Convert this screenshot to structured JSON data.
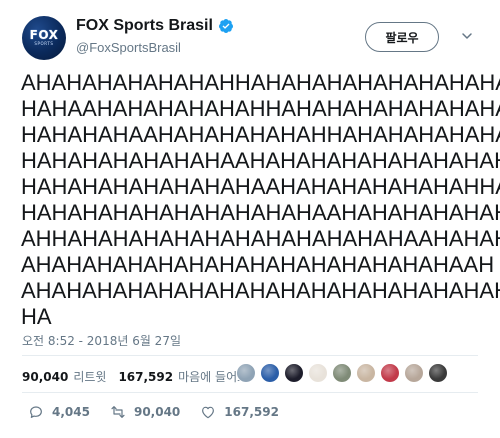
{
  "account": {
    "display_name": "FOX Sports Brasil",
    "handle": "@FoxSportsBrasil",
    "verified": true,
    "avatar_text": "FOX",
    "avatar_subtext": "SPORTS"
  },
  "follow_button": {
    "label": "팔로우"
  },
  "tweet": {
    "lines": [
      "AHAHAHAHAHAHAHHAHAHAHAHAHAHAHAHA",
      "HAHAAHAHAHAHAHAHHAHAHAHAHAHAHAHA",
      "HAHAHAHAAHAHAHAHAHAHHAHAHAHAHAHA",
      "HAHAHAHAHAHAHAAHAHAHAHAHAHAHAHAHA",
      "HAHAHAHAHAHAHAHAAHAHAHAHAHAHAHHA",
      "HAHAHAHAHAHAHAHAHAHAAHAHAHAHAHAH",
      "AHHAHAHAHAHAHAHAHAHAHAHAHAAHAHAH",
      "AHAHAHAHAHAHAHAHAHAHAHAHAHAHAAH",
      "AHAHAHAHAHAHAHAHAHAHAHAHAHAHAHAHA",
      "HA"
    ]
  },
  "timestamp": "오전 8:52 - 2018년 6월 27일",
  "stats": {
    "retweets_count": "90,040",
    "retweets_label": "리트윗",
    "likes_count": "167,592",
    "likes_label": "마음에 들어요"
  },
  "likers": [
    {
      "icon": "avatar-1",
      "color": "#8fa3b5"
    },
    {
      "icon": "avatar-2",
      "color": "#2b5ea8"
    },
    {
      "icon": "avatar-3",
      "color": "#1d1d2b"
    },
    {
      "icon": "avatar-4",
      "color": "#e8e2da"
    },
    {
      "icon": "avatar-5",
      "color": "#7f8b77"
    },
    {
      "icon": "avatar-6",
      "color": "#c9b6a2"
    },
    {
      "icon": "avatar-7",
      "color": "#c23a4a"
    },
    {
      "icon": "avatar-8",
      "color": "#b7a79a"
    },
    {
      "icon": "avatar-9",
      "color": "#3a3a3a"
    }
  ],
  "actions": {
    "reply_count": "4,045",
    "retweet_count": "90,040",
    "like_count": "167,592"
  },
  "colors": {
    "verified_blue": "#1da1f2",
    "muted_text": "#657786",
    "divider": "#e6ecf0"
  }
}
